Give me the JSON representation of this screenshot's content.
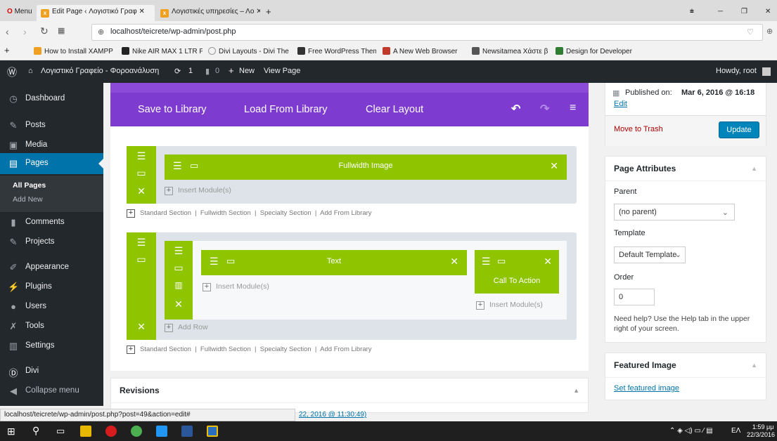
{
  "browser": {
    "menu_label": "Menu",
    "tabs": [
      {
        "title": "Edit Page ‹ Λογιστικό Γραφ"
      },
      {
        "title": "Λογιστικές υπηρεσίες – Λο"
      }
    ],
    "url": "localhost/teicrete/wp-admin/post.php",
    "bookmarks": [
      "How to Install XAMPP",
      "Nike AIR MAX 1 LTR P",
      "Divi Layouts - Divi The",
      "Free WordPress Them",
      "A New Web Browser",
      "Newsitamea Χάστε β",
      "Design for Developer"
    ]
  },
  "adminbar": {
    "site_name": "Λογιστικό Γραφείο - Φοροανάλυση",
    "updates": "1",
    "comments": "0",
    "new_label": "New",
    "view_label": "View Page",
    "howdy": "Howdy, root"
  },
  "sidebar": {
    "items": [
      {
        "label": "Dashboard",
        "icon": "dashboard-icon"
      },
      {
        "label": "Posts",
        "icon": "pin-icon"
      },
      {
        "label": "Media",
        "icon": "media-icon"
      },
      {
        "label": "Pages",
        "icon": "page-icon"
      },
      {
        "label": "Comments",
        "icon": "comment-icon"
      },
      {
        "label": "Projects",
        "icon": "pin-icon"
      },
      {
        "label": "Appearance",
        "icon": "brush-icon"
      },
      {
        "label": "Plugins",
        "icon": "plug-icon"
      },
      {
        "label": "Users",
        "icon": "user-icon"
      },
      {
        "label": "Tools",
        "icon": "wrench-icon"
      },
      {
        "label": "Settings",
        "icon": "settings-icon"
      },
      {
        "label": "Divi",
        "icon": "divi-icon"
      },
      {
        "label": "Collapse menu",
        "icon": "collapse-icon"
      }
    ],
    "submenu": [
      "All Pages",
      "Add New"
    ]
  },
  "builder": {
    "save_library": "Save to Library",
    "load_library": "Load From Library",
    "clear_layout": "Clear Layout",
    "section1_module": "Fullwidth Image",
    "insert_modules": "Insert Module(s)",
    "add_row": "Add Row",
    "text_module": "Text",
    "cta_module": "Call To Action",
    "section_links": [
      "Standard Section",
      "Fullwidth Section",
      "Specialty Section",
      "Add From Library"
    ]
  },
  "publish": {
    "published_prefix": "Published on:",
    "published_date": "Mar 6, 2016 @ 16:18",
    "edit": "Edit",
    "trash": "Move to Trash",
    "update": "Update"
  },
  "attributes": {
    "title": "Page Attributes",
    "parent_label": "Parent",
    "parent_value": "(no parent)",
    "template_label": "Template",
    "template_value": "Default Template",
    "order_label": "Order",
    "order_value": "0",
    "help": "Need help? Use the Help tab in the upper right of your screen."
  },
  "featured": {
    "title": "Featured Image",
    "link": "Set featured image"
  },
  "revisions": {
    "title": "Revisions",
    "entry_tail": "22, 2016 @ 11:30:49)"
  },
  "status_url": "localhost/teicrete/wp-admin/post.php?post=49&action=edit#",
  "taskbar": {
    "lang": "ΕΛ",
    "time": "1:59 μμ",
    "date": "22/3/2016"
  },
  "colors": {
    "divi_purple": "#7e3bd0",
    "divi_green": "#8fc400",
    "wp_blue": "#0073aa",
    "wp_dark": "#23282d"
  }
}
